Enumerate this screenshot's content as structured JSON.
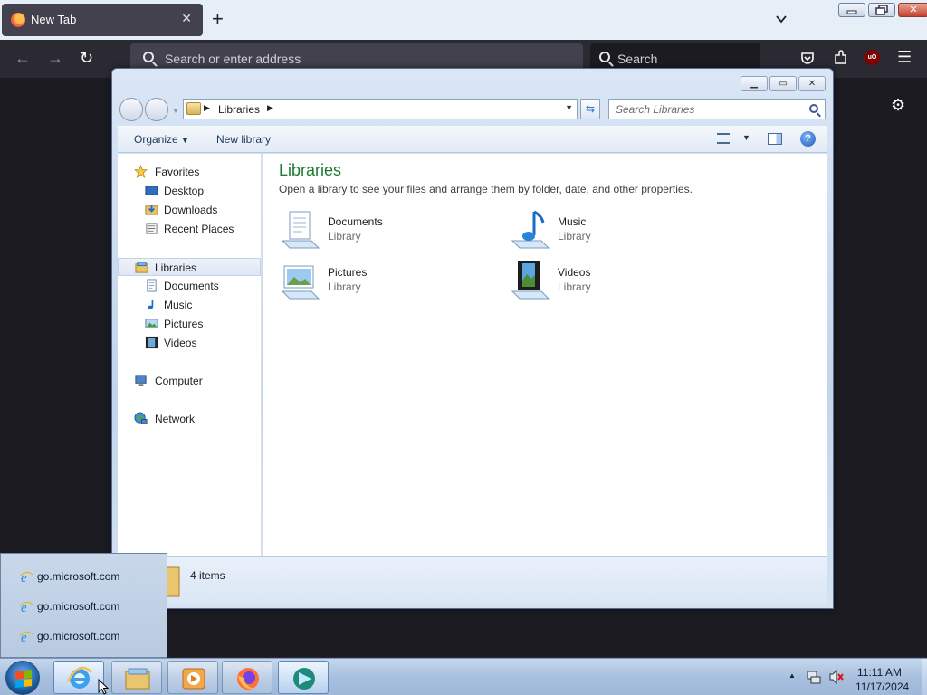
{
  "firefox": {
    "tab_title": "New Tab",
    "tab_close": "✕",
    "new_tab": "+",
    "address_placeholder": "Search or enter address",
    "search_placeholder": "Search",
    "back": "←",
    "forward": "→",
    "reload": "↻",
    "menu": "☰",
    "settings": "⚙",
    "extension_badge": "uO"
  },
  "explorer": {
    "breadcrumb": "Libraries",
    "search_placeholder": "Search Libraries",
    "toolbar": {
      "organize": "Organize",
      "new_library": "New library",
      "help": "?"
    },
    "nav": {
      "favorites": "Favorites",
      "desktop": "Desktop",
      "downloads": "Downloads",
      "recent_places": "Recent Places",
      "libraries": "Libraries",
      "documents": "Documents",
      "music": "Music",
      "pictures": "Pictures",
      "videos": "Videos",
      "computer": "Computer",
      "network": "Network"
    },
    "content": {
      "title": "Libraries",
      "subtitle": "Open a library to see your files and arrange them by folder, date, and other properties.",
      "items": [
        {
          "name": "Documents",
          "type": "Library"
        },
        {
          "name": "Music",
          "type": "Library"
        },
        {
          "name": "Pictures",
          "type": "Library"
        },
        {
          "name": "Videos",
          "type": "Library"
        }
      ]
    },
    "status": "4 items"
  },
  "jumplist": [
    {
      "label": "go.microsoft.com"
    },
    {
      "label": "go.microsoft.com"
    },
    {
      "label": "go.microsoft.com"
    }
  ],
  "taskbar": {
    "time": "11:11 AM",
    "date": "11/17/2024",
    "tray_expand": "▲"
  }
}
